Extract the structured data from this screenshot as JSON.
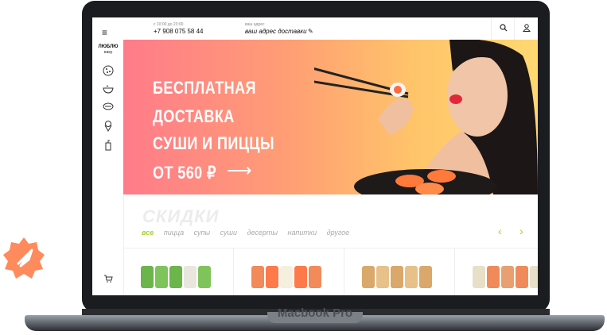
{
  "device": {
    "label": "Macbook Pro"
  },
  "header": {
    "hours": "с 10:00 до 23:00",
    "phone": "+7 908 075 58 44",
    "address_label": "ваш адрес",
    "address_value": "ваш адрес доставки"
  },
  "sidebar": {
    "logo_top": "ЛЮБЛЮ",
    "logo_bottom": "easy",
    "items": [
      {
        "icon": "pizza-icon"
      },
      {
        "icon": "bowl-icon"
      },
      {
        "icon": "sushi-icon"
      },
      {
        "icon": "ice-cream-icon"
      },
      {
        "icon": "drink-icon"
      }
    ]
  },
  "hero": {
    "line1": "БЕСПЛАТНАЯ",
    "line2": "ДОСТАВКА",
    "line3": "СУШИ И ПИЦЦЫ",
    "line4": "ОТ 560 ₽"
  },
  "discounts": {
    "title": "СКИДКИ",
    "categories": [
      "все",
      "пицца",
      "супы",
      "суши",
      "десерты",
      "напитки",
      "другое"
    ],
    "active_category": "все"
  },
  "colors": {
    "accent": "#a8d12a",
    "hero_gradient_start": "#ff7b8a",
    "hero_gradient_end": "#ffd870"
  }
}
